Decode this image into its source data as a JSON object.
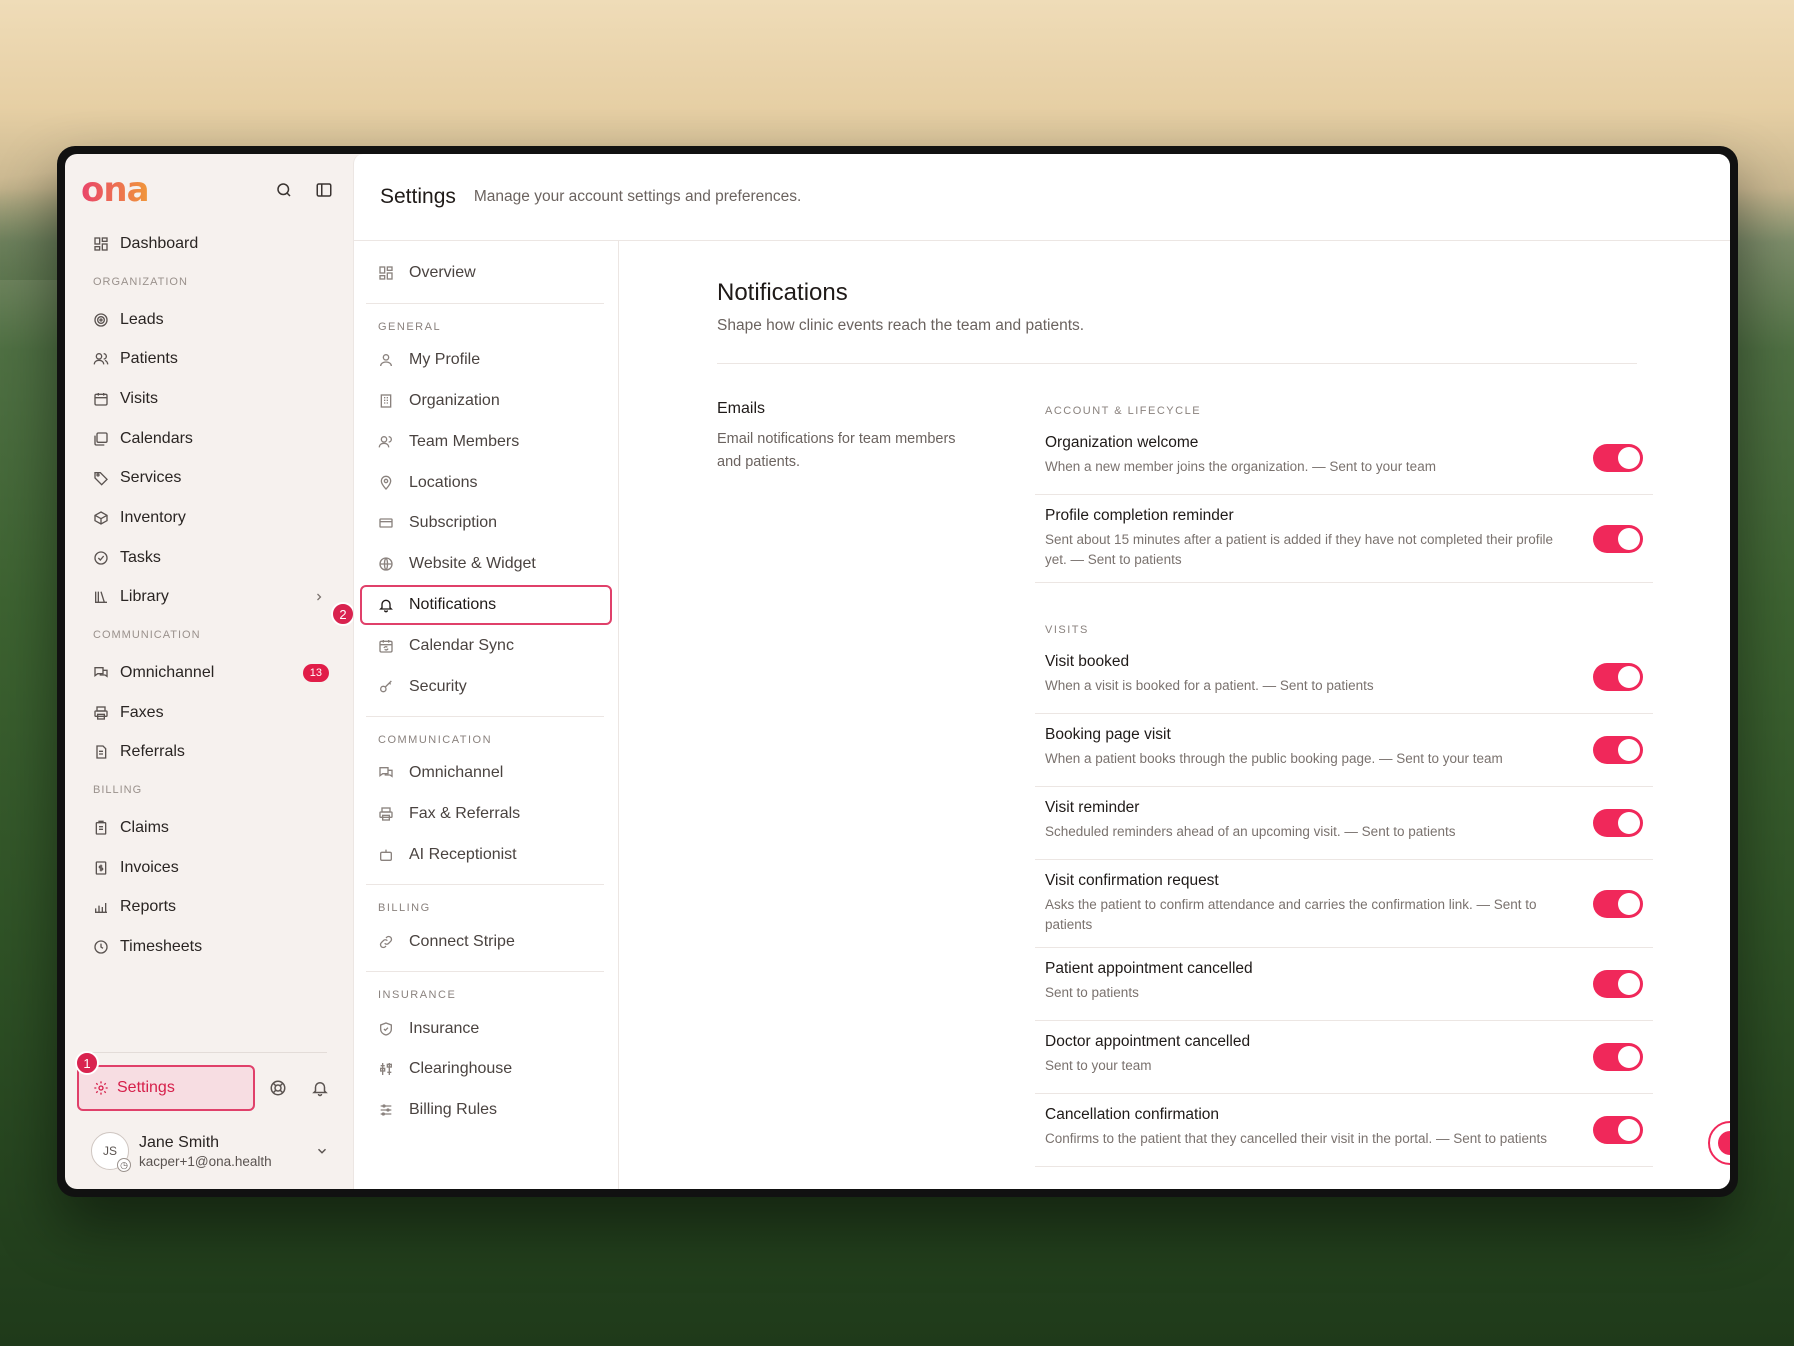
{
  "brand": {
    "logo": "ona"
  },
  "sidebar": {
    "dashboard": "Dashboard",
    "sections": [
      {
        "label": "ORGANIZATION",
        "items": [
          {
            "label": "Leads",
            "icon": "target-icon"
          },
          {
            "label": "Patients",
            "icon": "users-icon"
          },
          {
            "label": "Visits",
            "icon": "calendar-icon"
          },
          {
            "label": "Calendars",
            "icon": "calendars-icon"
          },
          {
            "label": "Services",
            "icon": "tag-icon"
          },
          {
            "label": "Inventory",
            "icon": "box-icon"
          },
          {
            "label": "Tasks",
            "icon": "check-circle-icon"
          },
          {
            "label": "Library",
            "icon": "library-icon"
          }
        ]
      },
      {
        "label": "COMMUNICATION",
        "items": [
          {
            "label": "Omnichannel",
            "icon": "chat-icon",
            "badge": "13"
          },
          {
            "label": "Faxes",
            "icon": "printer-icon"
          },
          {
            "label": "Referrals",
            "icon": "document-icon"
          }
        ]
      },
      {
        "label": "BILLING",
        "items": [
          {
            "label": "Claims",
            "icon": "clipboard-icon"
          },
          {
            "label": "Invoices",
            "icon": "invoice-icon"
          },
          {
            "label": "Reports",
            "icon": "bar-chart-icon"
          },
          {
            "label": "Timesheets",
            "icon": "clock-icon"
          }
        ]
      }
    ],
    "step_library": "2",
    "step_settings": "1",
    "settings_label": "Settings",
    "user": {
      "initials": "JS",
      "name": "Jane Smith",
      "email": "kacper+1@ona.health"
    }
  },
  "header": {
    "title": "Settings",
    "subtitle": "Manage your account settings and preferences."
  },
  "subnav": {
    "overview": "Overview",
    "sections": [
      {
        "label": "GENERAL",
        "items": [
          "My Profile",
          "Organization",
          "Team Members",
          "Locations",
          "Subscription",
          "Website & Widget",
          "Notifications",
          "Calendar Sync",
          "Security"
        ]
      },
      {
        "label": "COMMUNICATION",
        "items": [
          "Omnichannel",
          "Fax & Referrals",
          "AI Receptionist"
        ]
      },
      {
        "label": "BILLING",
        "items": [
          "Connect Stripe"
        ]
      },
      {
        "label": "INSURANCE",
        "items": [
          "Insurance",
          "Clearinghouse",
          "Billing Rules"
        ]
      }
    ],
    "active": "Notifications"
  },
  "content": {
    "title": "Notifications",
    "subtitle": "Shape how clinic events reach the team and patients.",
    "group": {
      "title": "Emails",
      "description": "Email notifications for team members and patients."
    },
    "categories": [
      {
        "label": "ACCOUNT & LIFECYCLE",
        "rows": [
          {
            "title": "Organization welcome",
            "desc": "When a new member joins the organization. — Sent to your team",
            "enabled": true
          },
          {
            "title": "Profile completion reminder",
            "desc": "Sent about 15 minutes after a patient is added if they have not completed their profile yet. — Sent to patients",
            "enabled": true
          }
        ]
      },
      {
        "label": "VISITS",
        "rows": [
          {
            "title": "Visit booked",
            "desc": "When a visit is booked for a patient. — Sent to patients",
            "enabled": true
          },
          {
            "title": "Booking page visit",
            "desc": "When a patient books through the public booking page. — Sent to your team",
            "enabled": true
          },
          {
            "title": "Visit reminder",
            "desc": "Scheduled reminders ahead of an upcoming visit. — Sent to patients",
            "enabled": true
          },
          {
            "title": "Visit confirmation request",
            "desc": "Asks the patient to confirm attendance and carries the confirmation link. — Sent to patients",
            "enabled": true
          },
          {
            "title": "Patient appointment cancelled",
            "desc": "Sent to patients",
            "enabled": true
          },
          {
            "title": "Doctor appointment cancelled",
            "desc": "Sent to your team",
            "enabled": true
          },
          {
            "title": "Cancellation confirmation",
            "desc": "Confirms to the patient that they cancelled their visit in the portal. — Sent to patients",
            "enabled": true
          }
        ]
      }
    ]
  },
  "colors": {
    "accent": "#f0285a",
    "brand_start": "#e9446a",
    "brand_end": "#f0983a"
  }
}
